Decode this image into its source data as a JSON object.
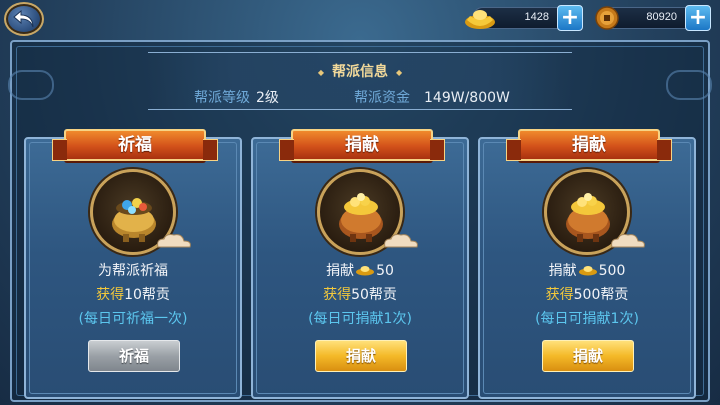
{
  "header": {
    "gold_amount": "1428",
    "coin_amount": "80920",
    "gold_icon": "gold-ingot-icon",
    "coin_icon": "copper-coin-icon",
    "back_icon": "back-arrow-icon",
    "plus_label": "+"
  },
  "info": {
    "title": "帮派信息",
    "level_label": "帮派等级",
    "level_value": "2级",
    "funds_label": "帮派资金",
    "funds_value": "149W/800W"
  },
  "cards": [
    {
      "ribbon": "祈福",
      "line1": "为帮派祈福",
      "gain_word": "获得",
      "gain_rest": "10帮贡",
      "note": "(每日可祈福一次)",
      "button": "祈福",
      "button_state": "disabled"
    },
    {
      "ribbon": "捐献",
      "line1_prefix": "捐献",
      "line1_amount": "50",
      "gain_word": "获得",
      "gain_rest": "50帮贡",
      "note": "(每日可捐献1次)",
      "button": "捐献",
      "button_state": "enabled"
    },
    {
      "ribbon": "捐献",
      "line1_prefix": "捐献",
      "line1_amount": "500",
      "gain_word": "获得",
      "gain_rest": "500帮贡",
      "note": "(每日可捐献1次)",
      "button": "捐献",
      "button_state": "enabled"
    }
  ],
  "colors": {
    "ribbon": "#d2511a",
    "gain_text": "#f3c93c",
    "note_text": "#5cc6ee",
    "label_text": "#6fa9d8"
  }
}
